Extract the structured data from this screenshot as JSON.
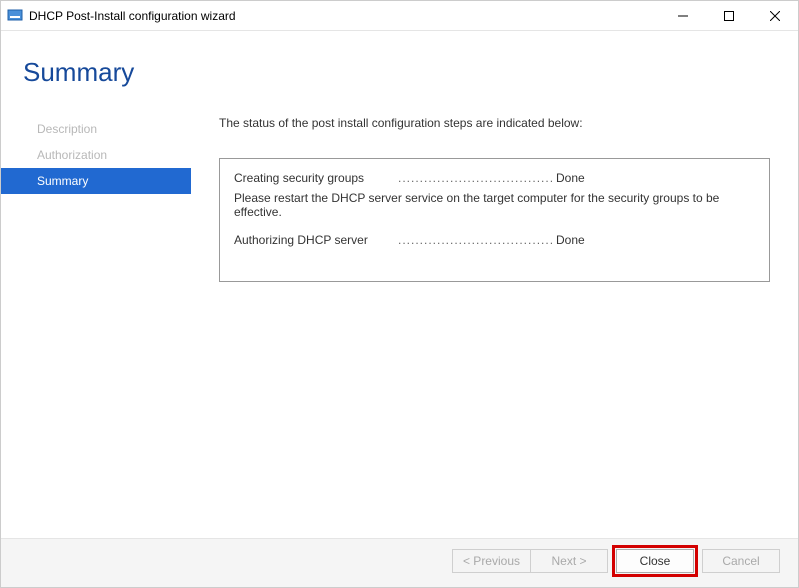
{
  "window": {
    "title": "DHCP Post-Install configuration wizard"
  },
  "heading": "Summary",
  "sidebar": {
    "items": [
      {
        "label": "Description"
      },
      {
        "label": "Authorization"
      },
      {
        "label": "Summary"
      }
    ]
  },
  "main": {
    "intro": "The status of the post install configuration steps are indicated below:",
    "steps": [
      {
        "label": "Creating security groups",
        "status": "Done",
        "message": "Please restart the DHCP server service on the target computer for the security groups to be effective."
      },
      {
        "label": "Authorizing DHCP server",
        "status": "Done",
        "message": ""
      }
    ]
  },
  "footer": {
    "previous": "< Previous",
    "next": "Next >",
    "close": "Close",
    "cancel": "Cancel"
  }
}
